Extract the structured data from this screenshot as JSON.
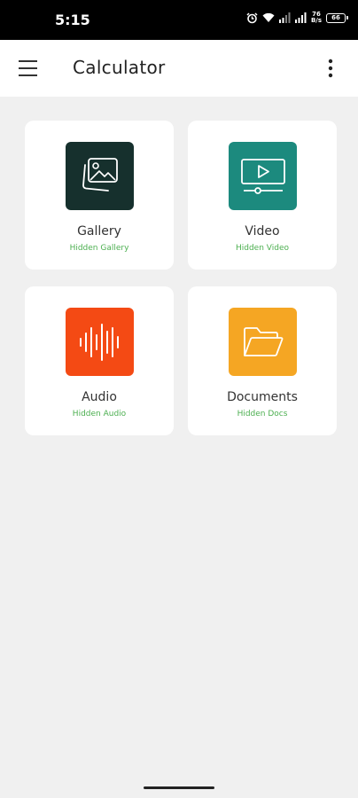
{
  "status_bar": {
    "time": "5:15",
    "network_speed_value": "76",
    "network_speed_unit": "B/s",
    "battery": "66"
  },
  "app_bar": {
    "title": "Calculator",
    "menu_icon": "hamburger-menu-icon",
    "more_icon": "more-vertical-icon"
  },
  "cards": [
    {
      "title": "Gallery",
      "subtitle": "Hidden Gallery",
      "icon": "gallery-icon",
      "color": "#16302d"
    },
    {
      "title": "Video",
      "subtitle": "Hidden Video",
      "icon": "video-icon",
      "color": "#1c8a7e"
    },
    {
      "title": "Audio",
      "subtitle": "Hidden Audio",
      "icon": "audio-waveform-icon",
      "color": "#f44a14"
    },
    {
      "title": "Documents",
      "subtitle": "Hidden Docs",
      "icon": "folder-icon",
      "color": "#f5a623"
    }
  ],
  "colors": {
    "subtitle": "#4caf50",
    "background": "#f0f0f0"
  }
}
